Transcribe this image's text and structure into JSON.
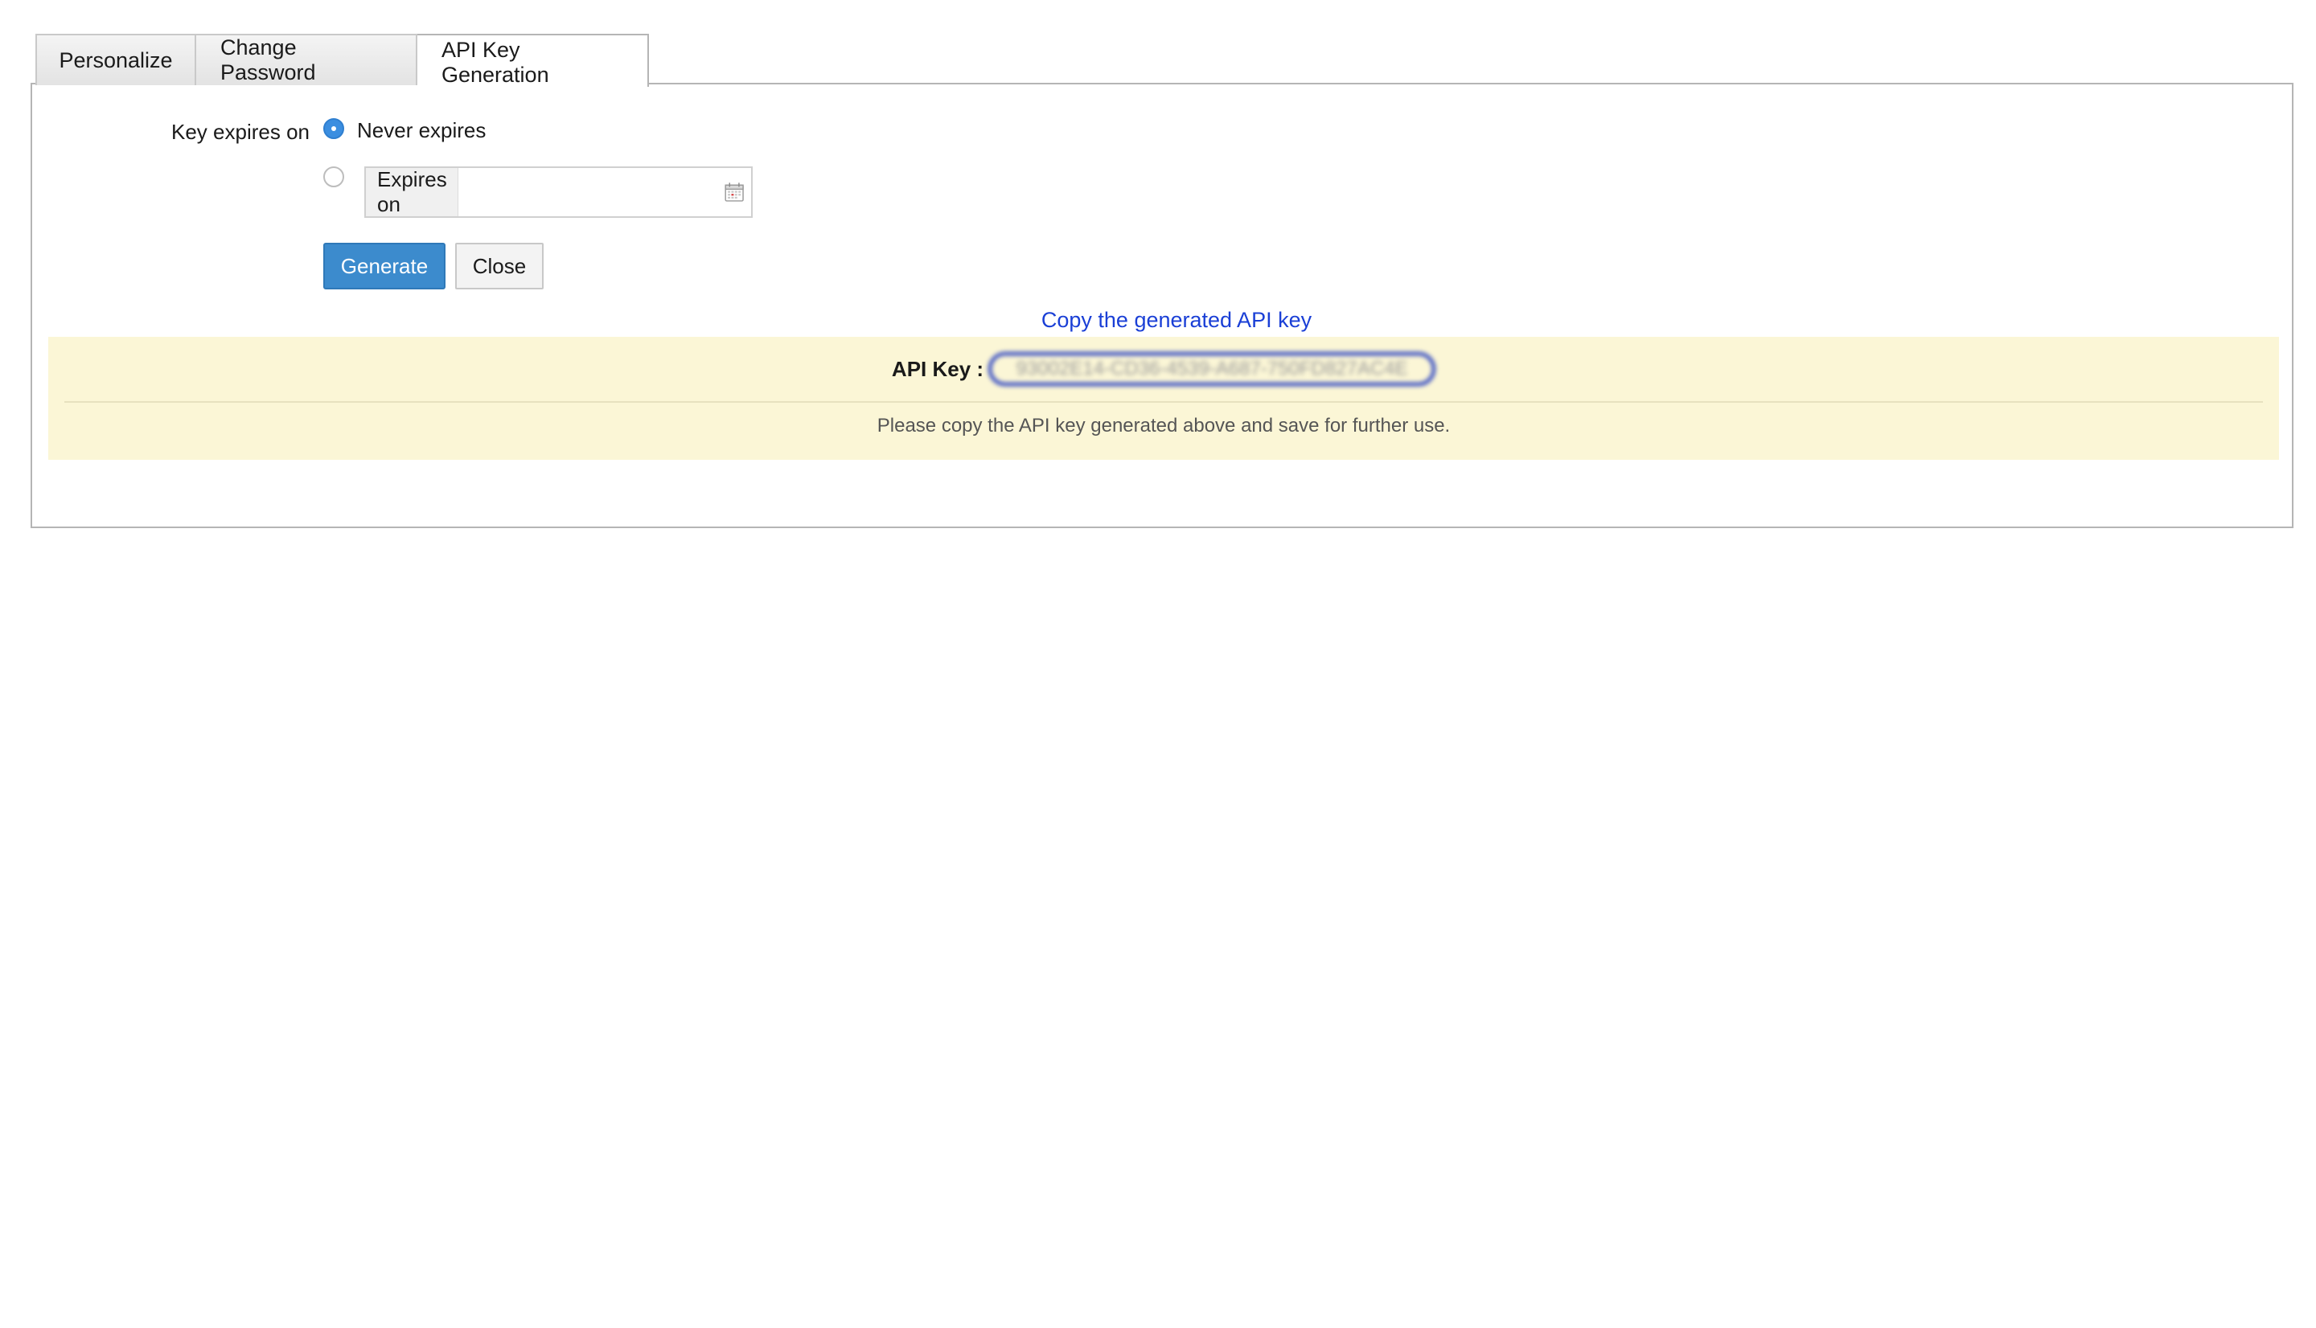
{
  "tabs": [
    {
      "label": "Personalize"
    },
    {
      "label": "Change Password"
    },
    {
      "label": "API Key Generation"
    }
  ],
  "form": {
    "expires_label": "Key expires on",
    "never_expires_label": "Never expires",
    "expires_on_label": "Expires on",
    "expires_on_value": ""
  },
  "buttons": {
    "generate": "Generate",
    "close": "Close"
  },
  "result": {
    "copy_link": "Copy the generated API key",
    "api_key_label": "API Key :",
    "api_key_value": "93002E14-CD36-4539-A687-750FD827AC4E",
    "note": "Please copy the API key generated above and save for further use."
  }
}
